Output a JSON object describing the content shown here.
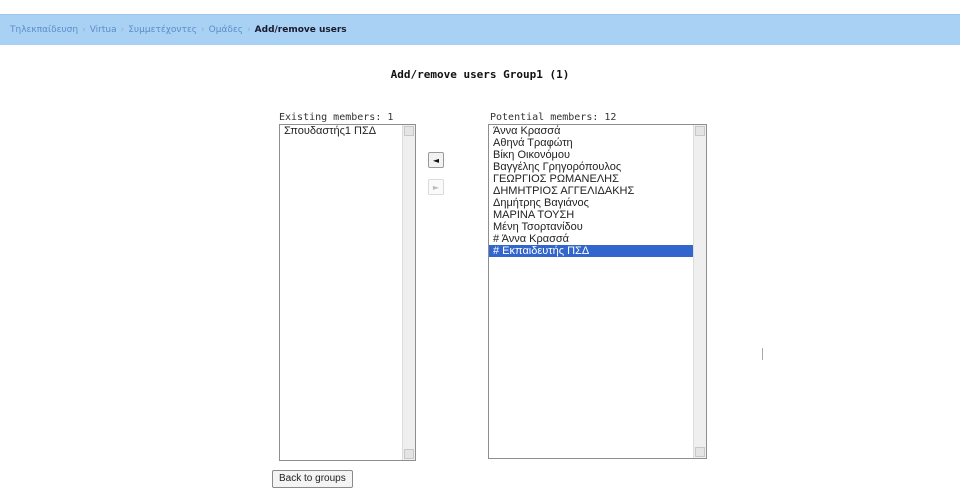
{
  "breadcrumb": [
    {
      "label": "Τηλεκπαίδευση",
      "current": false
    },
    {
      "label": "Virtua",
      "current": false
    },
    {
      "label": "Συμμετέχοντες",
      "current": false
    },
    {
      "label": "Ομάδες",
      "current": false
    },
    {
      "label": "Add/remove users",
      "current": true
    }
  ],
  "breadcrumb_separator": "›",
  "page_title": "Add/remove users Group1 (1)",
  "existing": {
    "label": "Existing members: 1",
    "items": [
      "Σπουδαστής1 ΠΣΔ"
    ]
  },
  "potential": {
    "label": "Potential members: 12",
    "items": [
      "Άννα Κρασσά",
      "Αθηνά Τραφώτη",
      "Βίκη Οικονόμου",
      "Βαγγέλης Γρηγορόπουλος",
      "ΓΕΩΡΓΙΟΣ ΡΩΜΑΝΕΛΗΣ",
      "ΔΗΜΗΤΡΙΟΣ ΑΓΓΕΛΙΔΑΚΗΣ",
      "Δημήτρης Βαγιάνος",
      "ΜΑΡΙΝΑ ΤΟΥΣΗ",
      "Μένη Τσορτανίδου",
      "# Άννα Κρασσά",
      "# Εκπαιδευτής ΠΣΔ"
    ],
    "selected_index": 10
  },
  "buttons": {
    "add": "◄",
    "remove": "►",
    "back": "Back to groups"
  },
  "colors": {
    "navbar": "#a9d1f3",
    "selection": "#3366cc"
  }
}
